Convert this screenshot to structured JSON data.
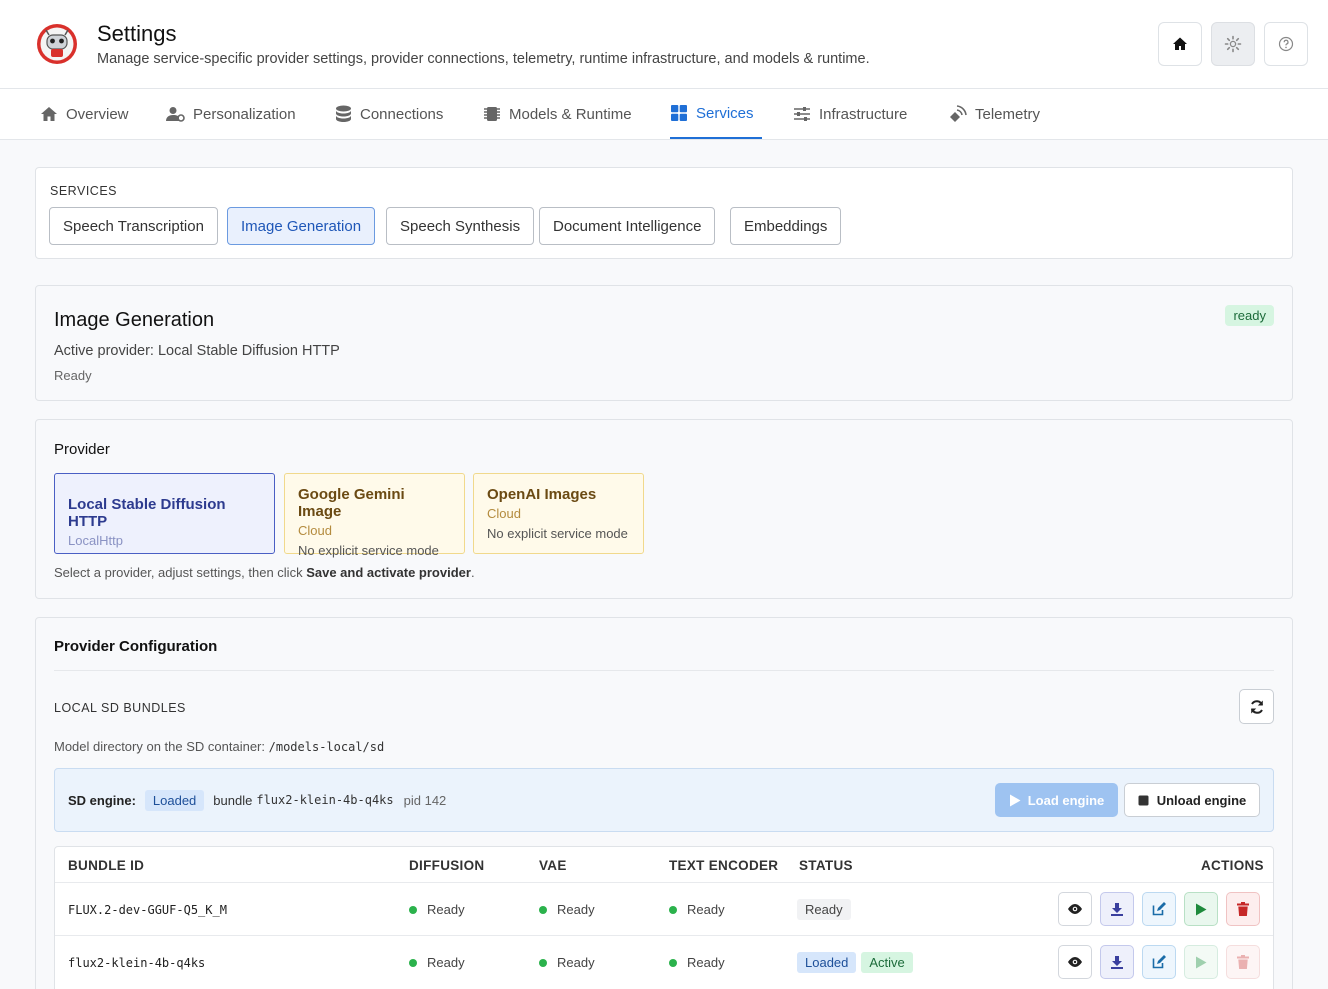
{
  "header": {
    "title": "Settings",
    "subtitle": "Manage service-specific provider settings, provider connections, telemetry, runtime infrastructure, and models & runtime."
  },
  "nav": {
    "tabs": [
      {
        "label": "Overview",
        "icon": "home-icon"
      },
      {
        "label": "Personalization",
        "icon": "user-gear-icon"
      },
      {
        "label": "Connections",
        "icon": "database-icon"
      },
      {
        "label": "Models & Runtime",
        "icon": "chip-icon"
      },
      {
        "label": "Services",
        "icon": "grid-icon",
        "active": true
      },
      {
        "label": "Infrastructure",
        "icon": "sliders-icon"
      },
      {
        "label": "Telemetry",
        "icon": "satellite-icon"
      }
    ]
  },
  "services": {
    "label": "SERVICES",
    "buttons": [
      "Speech Transcription",
      "Image Generation",
      "Speech Synthesis",
      "Document Intelligence",
      "Embeddings"
    ],
    "selected": "Image Generation"
  },
  "status_card": {
    "title": "Image Generation",
    "active_provider": "Active provider: Local Stable Diffusion HTTP",
    "state": "Ready",
    "badge": "ready"
  },
  "provider": {
    "title": "Provider",
    "options": [
      {
        "name": "Local Stable Diffusion HTTP",
        "type": "LocalHttp",
        "mode": ""
      },
      {
        "name": "Google Gemini Image",
        "type": "Cloud",
        "mode": "No explicit service mode"
      },
      {
        "name": "OpenAI Images",
        "type": "Cloud",
        "mode": "No explicit service mode"
      }
    ],
    "hint_prefix": "Select a provider, adjust settings, then click ",
    "hint_bold": "Save and activate provider",
    "hint_suffix": "."
  },
  "config": {
    "title": "Provider Configuration",
    "bundles_label": "LOCAL SD BUNDLES",
    "model_dir_label": "Model directory on the SD container:",
    "model_dir": "/models-local/sd",
    "engine": {
      "label": "SD engine:",
      "status": "Loaded",
      "bundle_label": "bundle",
      "bundle": "flux2-klein-4b-q4ks",
      "pid": "pid 142",
      "load_button": "Load engine",
      "unload_button": "Unload engine"
    },
    "table": {
      "headers": [
        "BUNDLE ID",
        "DIFFUSION",
        "VAE",
        "TEXT ENCODER",
        "STATUS",
        "ACTIONS"
      ],
      "rows": [
        {
          "id": "FLUX.2-dev-GGUF-Q5_K_M",
          "diffusion": "Ready",
          "vae": "Ready",
          "text_encoder": "Ready",
          "status": "Ready"
        },
        {
          "id": "flux2-klein-4b-q4ks",
          "diffusion": "Ready",
          "vae": "Ready",
          "text_encoder": "Ready",
          "status": "Loaded",
          "status2": "Active"
        }
      ]
    }
  },
  "colors": {
    "accent": "#1f6fd6",
    "ready_green": "#2bb24c",
    "danger": "#c62828",
    "play_green": "#1e8a3c"
  }
}
